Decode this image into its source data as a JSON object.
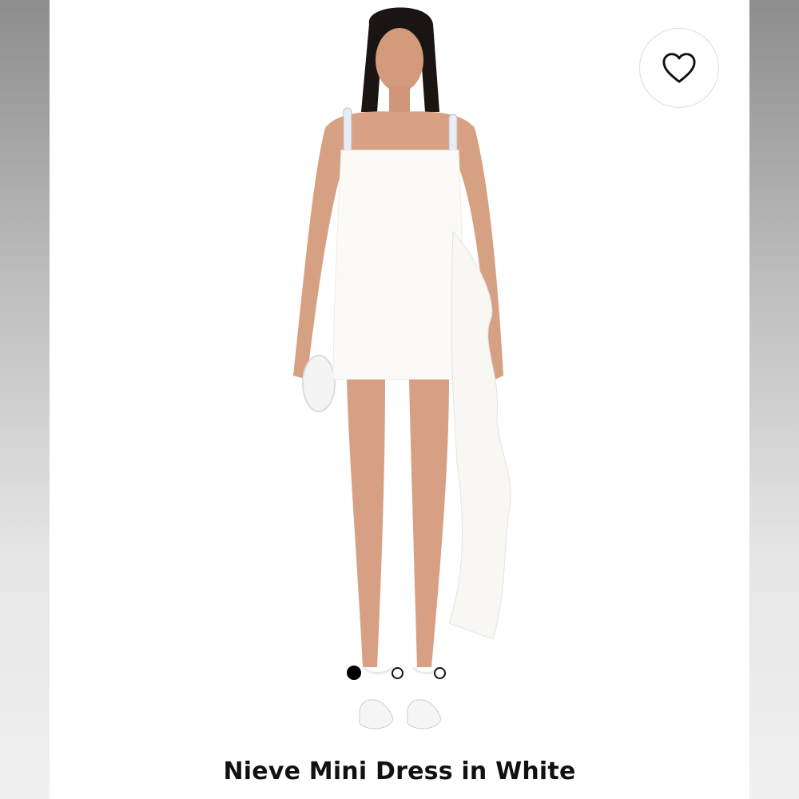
{
  "product": {
    "title": "Nieve Mini Dress in White"
  },
  "wishlist": {
    "icon": "heart-outline-icon"
  },
  "carousel": {
    "total": 3,
    "active_index": 0
  },
  "colors": {
    "dress": "#fbfaf7",
    "skin": "#d9a184",
    "hair": "#1a1512",
    "frame_grey": "#a9a9a9"
  }
}
